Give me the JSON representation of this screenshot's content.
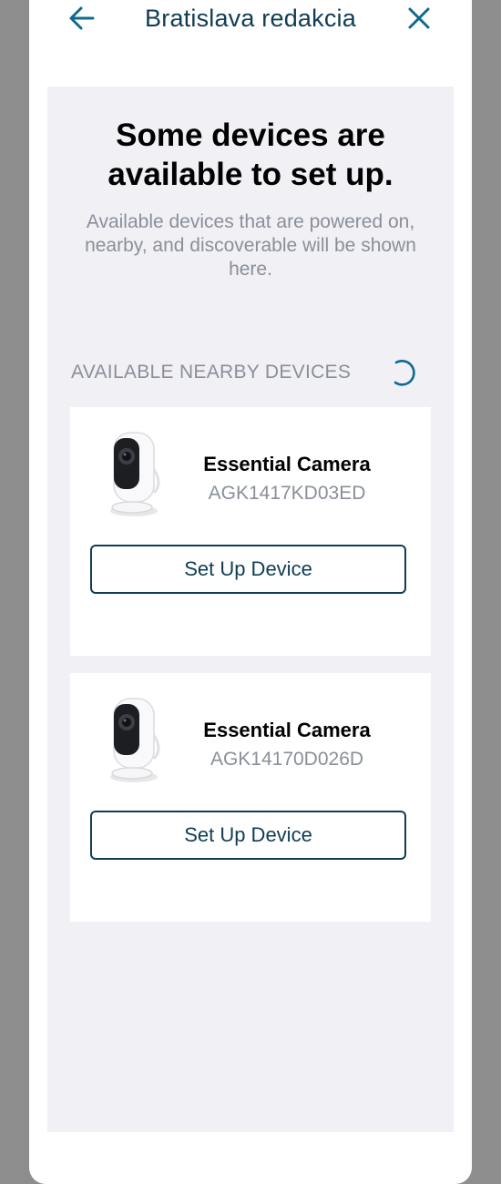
{
  "header": {
    "title": "Bratislava redakcia",
    "back_icon": "arrow-left-icon",
    "close_icon": "close-icon"
  },
  "main": {
    "headline": "Some devices are available to set up.",
    "subtext": "Available devices that are powered on, nearby, and discoverable will be shown here.",
    "section_label": "AVAILABLE NEARBY DEVICES",
    "loading_icon": "spinner-icon"
  },
  "devices": [
    {
      "name": "Essential Camera",
      "serial": "AGK1417KD03ED",
      "button_label": "Set Up Device",
      "image": "camera-icon"
    },
    {
      "name": "Essential Camera",
      "serial": "AGK14170D026D",
      "button_label": "Set Up Device",
      "image": "camera-icon"
    }
  ],
  "colors": {
    "accent": "#0f3d56",
    "panel_bg": "#f0f0f5",
    "muted_text": "#8a8f9a",
    "backdrop": "#8d8d8d"
  }
}
